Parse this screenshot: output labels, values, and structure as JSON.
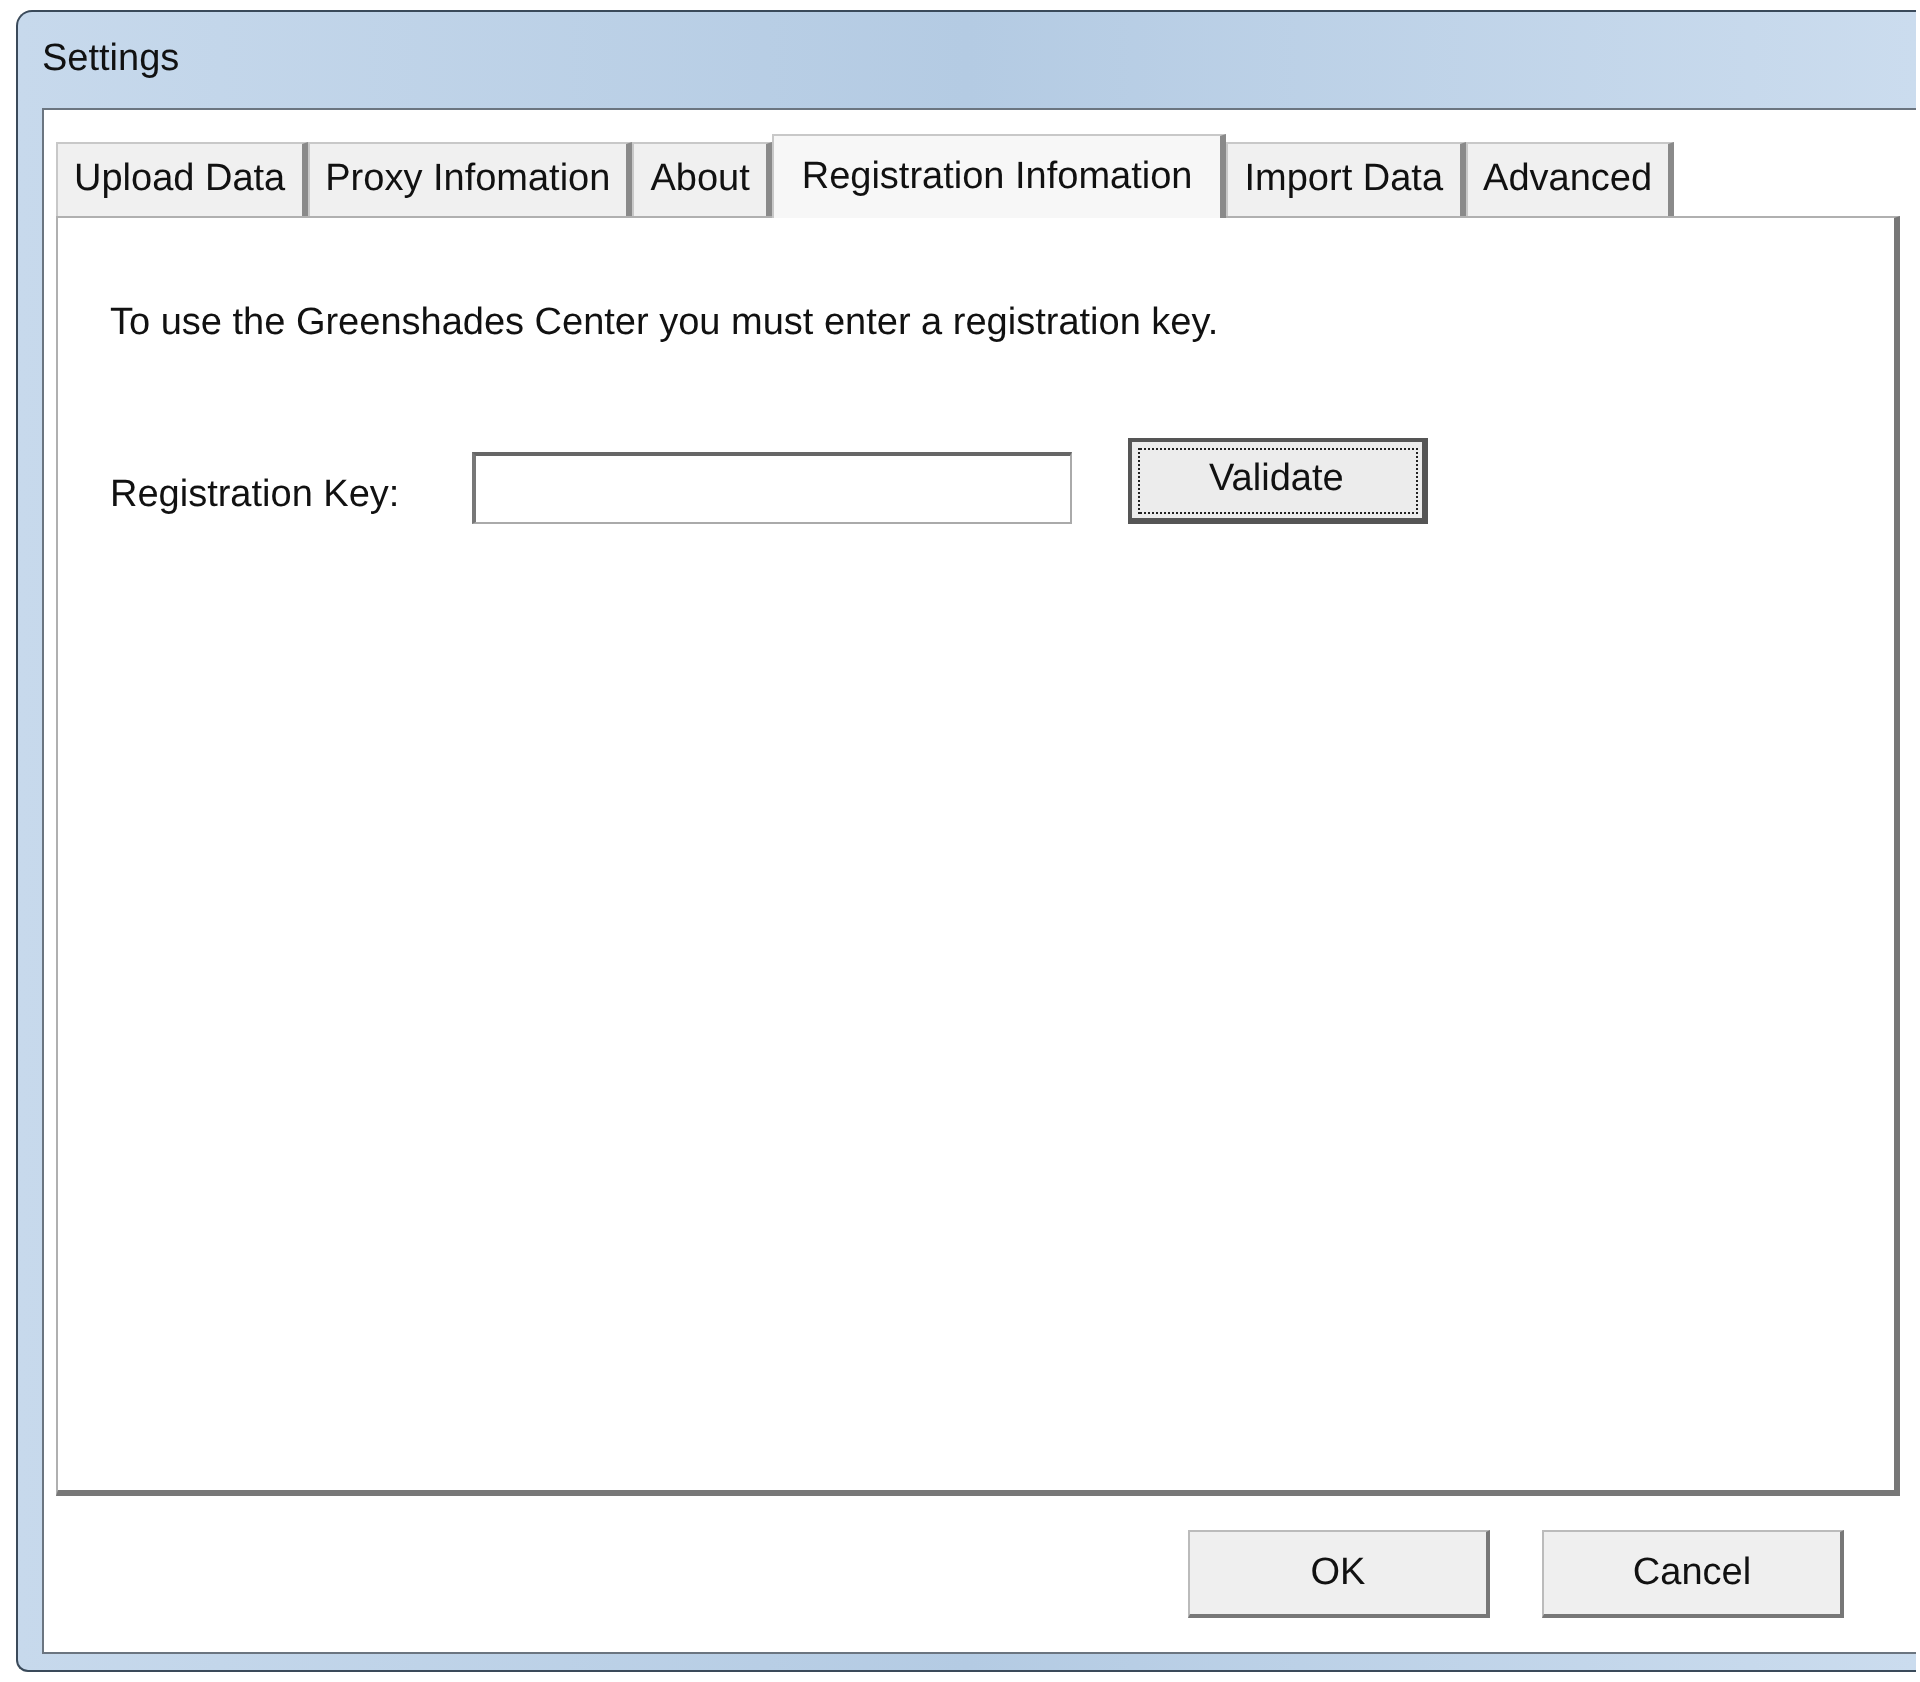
{
  "window": {
    "title": "Settings"
  },
  "tabs": [
    {
      "label": "Upload Data",
      "selected": false
    },
    {
      "label": "Proxy Infomation",
      "selected": false
    },
    {
      "label": "About",
      "selected": false
    },
    {
      "label": "Registration Infomation",
      "selected": true
    },
    {
      "label": "Import Data",
      "selected": false
    },
    {
      "label": "Advanced",
      "selected": false
    }
  ],
  "panel": {
    "intro": "To use the Greenshades Center you must enter a registration key.",
    "key_label": "Registration Key:",
    "validate_button": "Validate"
  },
  "buttons": [
    "OK",
    "Cancel"
  ]
}
